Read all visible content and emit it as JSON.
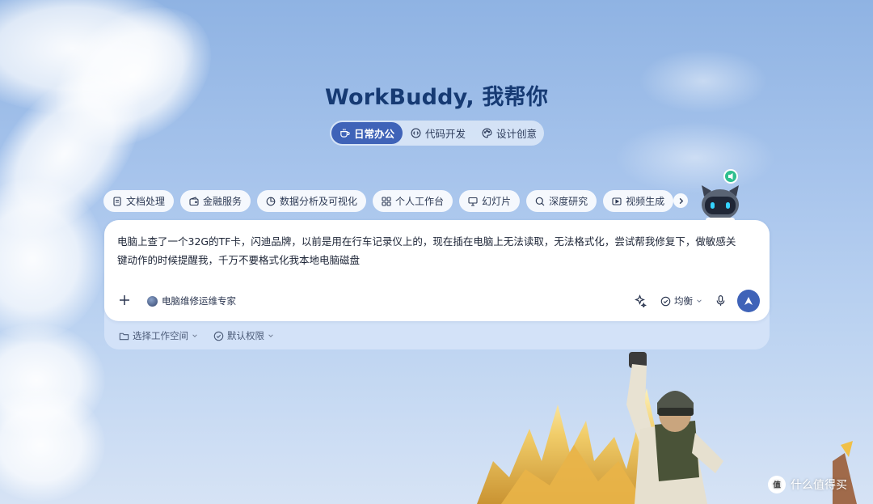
{
  "header": {
    "title": "WorkBuddy, 我帮你"
  },
  "mode_tabs": [
    {
      "label": "日常办公",
      "icon": "cup-icon",
      "active": true
    },
    {
      "label": "代码开发",
      "icon": "code-icon",
      "active": false
    },
    {
      "label": "设计创意",
      "icon": "palette-icon",
      "active": false
    }
  ],
  "chips": [
    {
      "label": "文档处理",
      "icon": "document-icon"
    },
    {
      "label": "金融服务",
      "icon": "wallet-icon"
    },
    {
      "label": "数据分析及可视化",
      "icon": "pie-chart-icon"
    },
    {
      "label": "个人工作台",
      "icon": "grid-icon"
    },
    {
      "label": "幻灯片",
      "icon": "presentation-icon"
    },
    {
      "label": "深度研究",
      "icon": "search-icon"
    },
    {
      "label": "视频生成",
      "icon": "video-icon"
    }
  ],
  "composer": {
    "prompt_text": "电脑上查了一个32G的TF卡，闪迪品牌，以前是用在行车记录仪上的，现在插在电脑上无法读取，无法格式化，尝试帮我修复下，做敏感关键动作的时候提醒我，千万不要格式化我本地电脑磁盘",
    "agent_label": "电脑维修运维专家",
    "mode_label": "均衡"
  },
  "footer": {
    "workspace_label": "选择工作空间",
    "permission_label": "默认权限"
  },
  "watermark": {
    "text": "什么值得买"
  },
  "colors": {
    "accent": "#3f63b8",
    "title": "#163a73",
    "badge": "#2fbf8f"
  }
}
